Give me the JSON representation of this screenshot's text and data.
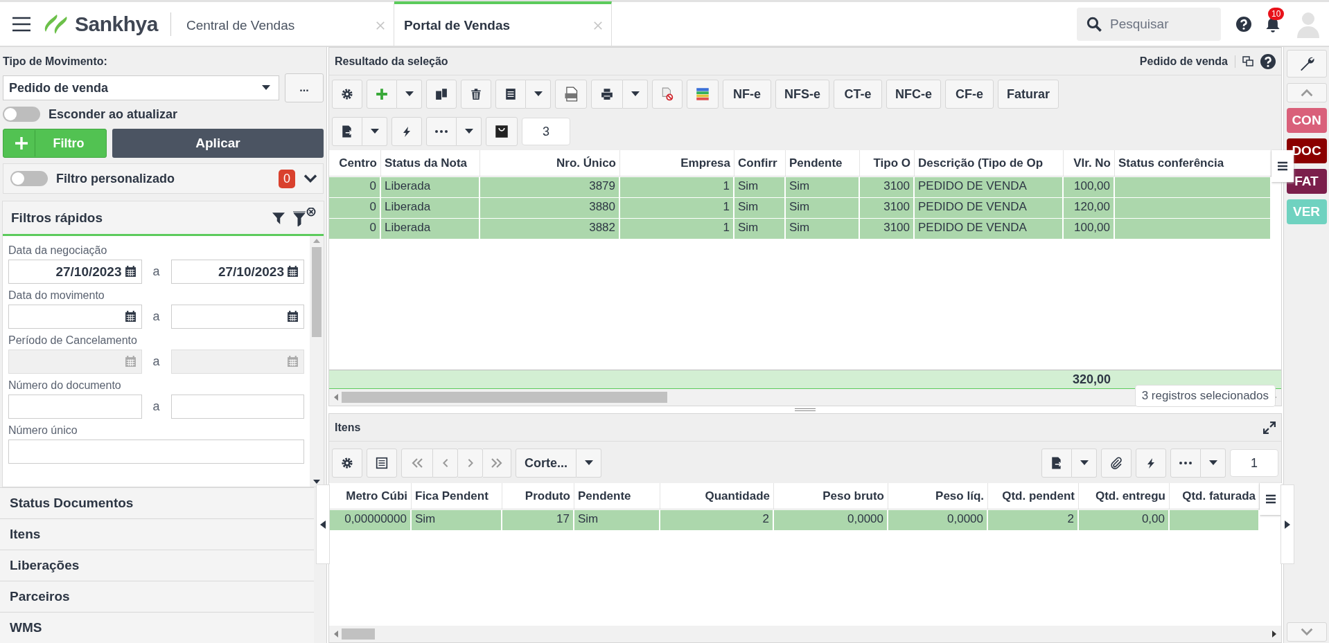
{
  "topbar": {
    "brand": "Sankhya",
    "tabs": [
      {
        "label": "Central de Vendas",
        "selected": false
      },
      {
        "label": "Portal de Vendas",
        "selected": true
      }
    ],
    "search": {
      "placeholder": "Pesquisar"
    },
    "notifications": "10"
  },
  "left": {
    "movement_label": "Tipo de Movimento:",
    "movement_value": "Pedido de venda",
    "more_button": "...",
    "hide_toggle": {
      "label": "Esconder ao atualizar",
      "on": false
    },
    "filter_button": "Filtro",
    "apply_button": "Aplicar",
    "custom_filter": {
      "label": "Filtro personalizado",
      "on": false,
      "count": "0"
    },
    "quick_filters": {
      "title": "Filtros rápidos",
      "fields": [
        {
          "kind": "date_range",
          "label": "Data da negociação",
          "from": "27/10/2023",
          "to": "27/10/2023",
          "joiner": "a",
          "disabled": false
        },
        {
          "kind": "date_range",
          "label": "Data do movimento",
          "joiner": "a",
          "disabled": false
        },
        {
          "kind": "date_range",
          "label": "Período de Cancelamento",
          "joiner": "a",
          "disabled": true
        },
        {
          "kind": "text_range",
          "label": "Número do documento",
          "joiner": "a",
          "disabled": false
        },
        {
          "kind": "text",
          "label": "Número único",
          "disabled": false
        }
      ]
    },
    "sections": [
      "Status Documentos",
      "Itens",
      "Liberações",
      "Parceiros",
      "WMS"
    ]
  },
  "main": {
    "title": "Resultado da seleção",
    "context": "Pedido de venda",
    "action_buttons": [
      "NF-e",
      "NFS-e",
      "CT-e",
      "NFC-e",
      "CF-e",
      "Faturar"
    ],
    "count": "3",
    "columns": [
      {
        "label": "Centro",
        "kind": "number"
      },
      {
        "label": "Status da Nota",
        "kind": "text"
      },
      {
        "label": "Nro. Único",
        "kind": "number"
      },
      {
        "label": "Empresa",
        "kind": "number"
      },
      {
        "label": "Confirr",
        "kind": "text"
      },
      {
        "label": "Pendente",
        "kind": "text"
      },
      {
        "label": "Tipo O",
        "kind": "number"
      },
      {
        "label": "Descrição (Tipo de Op",
        "kind": "text"
      },
      {
        "label": "Vlr. No",
        "kind": "number"
      },
      {
        "label": "Status conferência",
        "kind": "text"
      }
    ],
    "rows": [
      {
        "cells": [
          "0",
          "Liberada",
          "3879",
          "1",
          "Sim",
          "Sim",
          "3100",
          "PEDIDO DE VENDA",
          "100,00"
        ],
        "selected": true
      },
      {
        "cells": [
          "0",
          "Liberada",
          "3880",
          "1",
          "Sim",
          "Sim",
          "3100",
          "PEDIDO DE VENDA",
          "120,00"
        ],
        "selected": true
      },
      {
        "cells": [
          "0",
          "Liberada",
          "3882",
          "1",
          "Sim",
          "Sim",
          "3100",
          "PEDIDO DE VENDA",
          "100,00"
        ],
        "selected": true
      }
    ],
    "total": "320,00",
    "selection_note": "3 registros selecionados"
  },
  "items": {
    "title": "Itens",
    "split_button": "Corte...",
    "count": "1",
    "columns": [
      {
        "label": "Metro Cúbi",
        "kind": "number"
      },
      {
        "label": "Fica Pendent",
        "kind": "text"
      },
      {
        "label": "Produto",
        "kind": "number"
      },
      {
        "label": "Pendente",
        "kind": "text"
      },
      {
        "label": "Quantidade",
        "kind": "number"
      },
      {
        "label": "Peso bruto",
        "kind": "number"
      },
      {
        "label": "Peso líq.",
        "kind": "number"
      },
      {
        "label": "Qtd. pendent",
        "kind": "number"
      },
      {
        "label": "Qtd. entregu",
        "kind": "number"
      },
      {
        "label": "Qtd. faturada",
        "kind": "number"
      }
    ],
    "rows": [
      {
        "cells": [
          "0,00000000",
          "Sim",
          "17",
          "Sim",
          "2",
          "0,0000",
          "0,0000",
          "2",
          "0,00"
        ],
        "selected": true
      }
    ]
  },
  "side_tags": [
    {
      "label": "CON",
      "color": "#d9607a"
    },
    {
      "label": "DOC",
      "color": "#8b0000"
    },
    {
      "label": "FAT",
      "color": "#7b1f4b"
    },
    {
      "label": "VER",
      "color": "#6fd2c0"
    }
  ]
}
